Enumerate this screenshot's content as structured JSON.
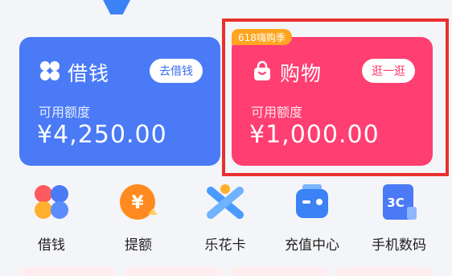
{
  "cards": {
    "loan": {
      "title": "借钱",
      "action": "去借钱",
      "label": "可用额度",
      "amount": "¥4,250.00"
    },
    "shop": {
      "badge": "618嗨购季",
      "title": "购物",
      "action": "逛一逛",
      "label": "可用额度",
      "amount": "¥1,000.00"
    }
  },
  "shortcuts": [
    {
      "label": "借钱",
      "icon": "four-petal-icon"
    },
    {
      "label": "提额",
      "icon": "yuan-up-icon"
    },
    {
      "label": "乐花卡",
      "icon": "lehua-card-icon"
    },
    {
      "label": "充值中心",
      "icon": "recharge-icon"
    },
    {
      "label": "手机数码",
      "icon": "phone-3c-icon"
    }
  ],
  "colors": {
    "loan_card": "#4a7af6",
    "shop_card": "#ff3e71",
    "badge": "#ffa51f",
    "highlight": "#e8302c"
  }
}
